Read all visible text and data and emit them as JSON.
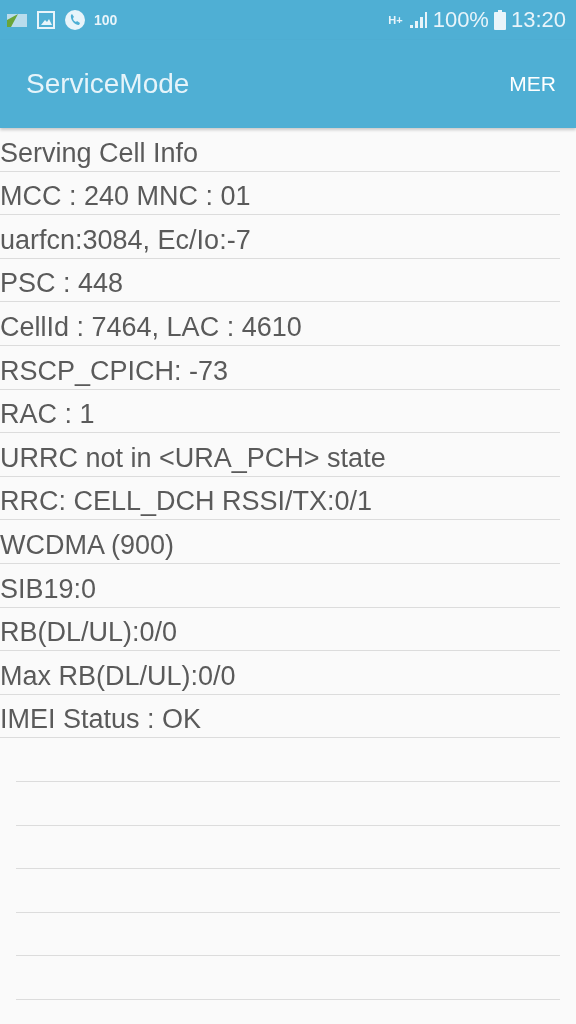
{
  "status_bar": {
    "notification_count": "100",
    "network_type": "H+",
    "battery": "100%",
    "time": "13:20"
  },
  "app_bar": {
    "title": "ServiceMode",
    "action": "MER"
  },
  "rows": [
    "Serving Cell Info",
    "MCC : 240 MNC : 01",
    "uarfcn:3084, Ec/Io:-7",
    "PSC : 448",
    "CellId : 7464, LAC : 4610",
    "RSCP_CPICH: -73",
    "RAC : 1",
    "URRC not in <URA_PCH> state",
    "RRC: CELL_DCH RSSI/TX:0/1",
    "WCDMA (900)",
    "SIB19:0",
    "RB(DL/UL):0/0",
    "Max RB(DL/UL):0/0",
    "IMEI Status : OK"
  ]
}
